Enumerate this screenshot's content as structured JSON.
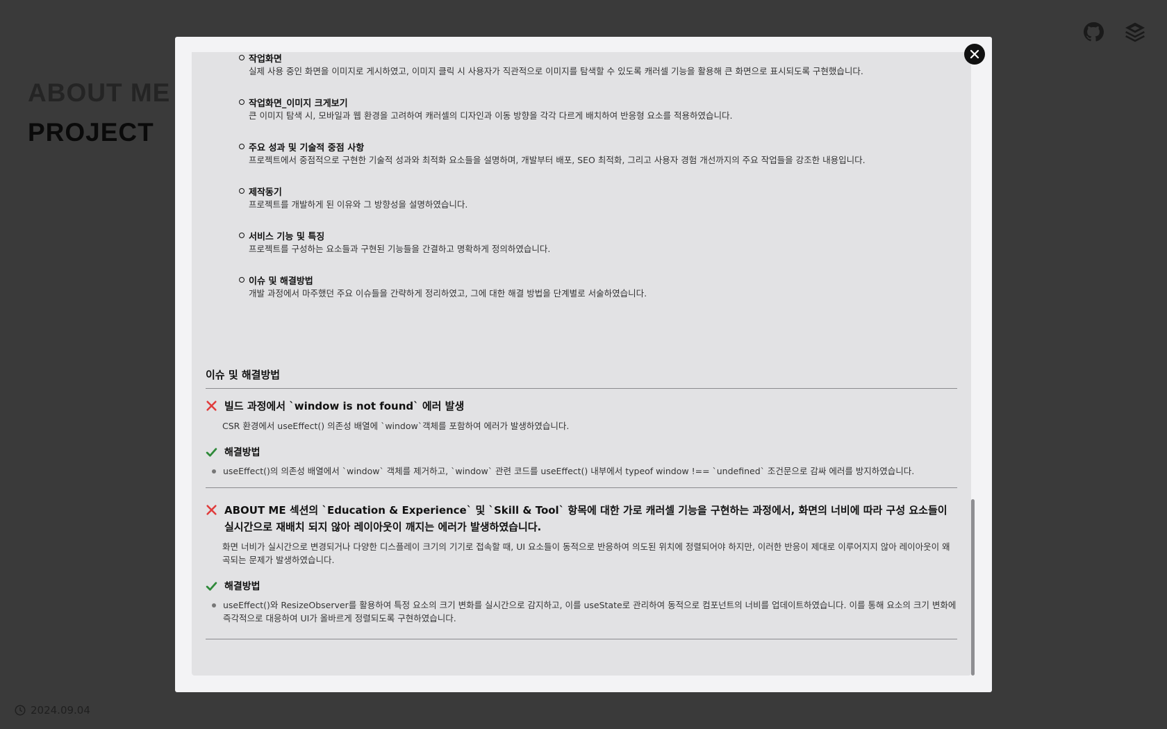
{
  "background": {
    "nav": [
      {
        "label": "ABOUT ME",
        "active": false
      },
      {
        "label": "PROJECT",
        "active": true
      }
    ],
    "date": "2024.09.04",
    "icons": [
      "github-icon",
      "layers-icon"
    ]
  },
  "modal": {
    "close_icon": "close-icon",
    "toc": [
      {
        "title": "작업화면",
        "desc": "실제 사용 중인 화면을 이미지로 게시하였고, 이미지 클릭 시 사용자가 직관적으로 이미지를 탐색할 수 있도록 캐러셀 기능을 활용해 큰 화면으로 표시되도록 구현했습니다."
      },
      {
        "title": "작업화면_이미지 크게보기",
        "desc": "큰 이미지 탐색 시, 모바일과 웹 환경을 고려하여 캐러셀의 디자인과 이동 방향을 각각 다르게 배치하여 반응형 요소를 적용하였습니다."
      },
      {
        "title": "주요 성과 및 기술적 중점 사항",
        "desc": "프로젝트에서 중점적으로 구현한 기술적 성과와 최적화 요소들을 설명하며, 개발부터 배포, SEO 최적화, 그리고 사용자 경험 개선까지의 주요 작업들을 강조한 내용입니다."
      },
      {
        "title": "제작동기",
        "desc": "프로젝트를 개발하게 된 이유와 그 방향성을 설명하였습니다."
      },
      {
        "title": "서비스 기능 및 특징",
        "desc": "프로젝트를 구성하는 요소들과 구현된 기능들을 간결하고 명확하게 정의하였습니다."
      },
      {
        "title": "이슈 및 해결방법",
        "desc": "개발 과정에서 마주했던 주요 이슈들을 간략하게 정리하였고, 그에 대한 해결 방법을 단계별로 서술하였습니다."
      }
    ],
    "issues_section": {
      "title": "이슈 및 해결방법",
      "items": [
        {
          "title": "빌드 과정에서 `window is not found` 에러 발생",
          "desc": "CSR 환경에서 useEffect() 의존성 배열에 `window`객체를 포함하여 에러가 발생하였습니다.",
          "fix_title": "해결방법",
          "fixes": [
            "useEffect()의 의존성 배열에서 `window` 객체를 제거하고, `window` 관련 코드를 useEffect() 내부에서 typeof window !== `undefined` 조건문으로 감싸 에러를 방지하였습니다."
          ]
        },
        {
          "title": "ABOUT ME 섹션의 `Education & Experience` 및 `Skill & Tool` 항목에 대한 가로 캐러셀 기능을 구현하는 과정에서, 화면의 너비에 따라 구성 요소들이 실시간으로 재배치 되지 않아 레이아웃이 깨지는 에러가 발생하였습니다.",
          "desc": "화면 너비가 실시간으로 변경되거나 다양한 디스플레이 크기의 기기로 접속할 때, UI 요소들이 동적으로 반응하여 의도된 위치에 정렬되어야 하지만, 이러한 반응이 제대로 이루어지지 않아 레이아웃이 왜곡되는 문제가 발생하였습니다.",
          "fix_title": "해결방법",
          "fixes": [
            "useEffect()와 ResizeObserver를 활용하여 특정 요소의 크기 변화를 실시간으로 감지하고, 이를 useState로 관리하여 동적으로 컴포넌트의 너비를 업데이트하였습니다. 이를 통해 요소의 크기 변화에 즉각적으로 대응하여 UI가 올바르게 정렬되도록 구현하였습니다."
          ]
        }
      ]
    }
  },
  "colors": {
    "overlay": "#3a3a3a",
    "modal_bg": "#f3f3f5",
    "card_bg": "#e2e2e4",
    "error_x": "#e03b3b",
    "success_check": "#2f8a3a"
  }
}
